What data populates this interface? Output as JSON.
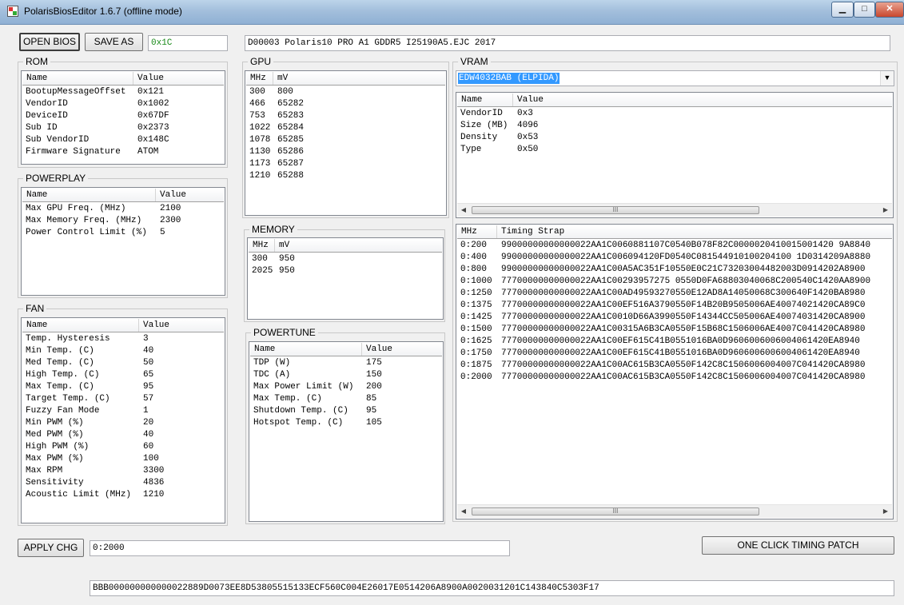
{
  "window": {
    "title": "PolarisBiosEditor 1.6.7 (offline mode)",
    "minimize": "▁",
    "maximize": "□",
    "close": "✕"
  },
  "toolbar": {
    "open_label": "OPEN BIOS",
    "save_label": "SAVE AS",
    "checksum": "0x1C",
    "bios_info": "D00003 Polaris10 PRO A1 GDDR5 I25190A5.EJC 2017"
  },
  "rom": {
    "title": "ROM",
    "columns": [
      "Name",
      "Value"
    ],
    "rows": [
      [
        "BootupMessageOffset",
        "0x121"
      ],
      [
        "VendorID",
        "0x1002"
      ],
      [
        "DeviceID",
        "0x67DF"
      ],
      [
        "Sub ID",
        "0x2373"
      ],
      [
        "Sub VendorID",
        "0x148C"
      ],
      [
        "Firmware Signature",
        "ATOM"
      ]
    ]
  },
  "powerplay": {
    "title": "POWERPLAY",
    "columns": [
      "Name",
      "Value"
    ],
    "rows": [
      [
        "Max GPU Freq. (MHz)",
        "2100"
      ],
      [
        "Max Memory Freq. (MHz)",
        "2300"
      ],
      [
        "Power Control Limit (%)",
        "5"
      ]
    ]
  },
  "fan": {
    "title": "FAN",
    "columns": [
      "Name",
      "Value"
    ],
    "rows": [
      [
        "Temp. Hysteresis",
        "3"
      ],
      [
        "Min Temp. (C)",
        "40"
      ],
      [
        "Med Temp. (C)",
        "50"
      ],
      [
        "High Temp. (C)",
        "65"
      ],
      [
        "Max Temp. (C)",
        "95"
      ],
      [
        "Target Temp. (C)",
        "57"
      ],
      [
        "Fuzzy Fan Mode",
        "1"
      ],
      [
        "Min PWM (%)",
        "20"
      ],
      [
        "Med PWM (%)",
        "40"
      ],
      [
        "High PWM (%)",
        "60"
      ],
      [
        "Max PWM (%)",
        "100"
      ],
      [
        "Max RPM",
        "3300"
      ],
      [
        "Sensitivity",
        "4836"
      ],
      [
        "Acoustic Limit (MHz)",
        "1210"
      ]
    ]
  },
  "gpu": {
    "title": "GPU",
    "columns": [
      "MHz",
      "mV"
    ],
    "rows": [
      [
        "300",
        "800"
      ],
      [
        "466",
        "65282"
      ],
      [
        "753",
        "65283"
      ],
      [
        "1022",
        "65284"
      ],
      [
        "1078",
        "65285"
      ],
      [
        "1130",
        "65286"
      ],
      [
        "1173",
        "65287"
      ],
      [
        "1210",
        "65288"
      ]
    ]
  },
  "memory": {
    "title": "MEMORY",
    "columns": [
      "MHz",
      "mV"
    ],
    "rows": [
      [
        "300",
        "950"
      ],
      [
        "2025",
        "950"
      ]
    ]
  },
  "powertune": {
    "title": "POWERTUNE",
    "columns": [
      "Name",
      "Value"
    ],
    "rows": [
      [
        "TDP (W)",
        "175"
      ],
      [
        "TDC (A)",
        "150"
      ],
      [
        "Max Power Limit (W)",
        "200"
      ],
      [
        "Max Temp. (C)",
        "85"
      ],
      [
        "Shutdown Temp. (C)",
        "95"
      ],
      [
        "Hotspot Temp. (C)",
        "105"
      ]
    ]
  },
  "vram": {
    "title": "VRAM",
    "selected_chip": "EDW4032BAB (ELPIDA)",
    "columns": [
      "Name",
      "Value"
    ],
    "rows": [
      [
        "VendorID",
        "0x3"
      ],
      [
        "Size (MB)",
        "4096"
      ],
      [
        "Density",
        "0x53"
      ],
      [
        "Type",
        "0x50"
      ]
    ],
    "timing_columns": [
      "MHz",
      "Timing Strap"
    ],
    "timings": [
      [
        "0:200",
        "99000000000000022AA1C0060881107C0540B078F82C0000020410015001420 9A8840"
      ],
      [
        "0:400",
        "99000000000000022AA1C006094120FD0540C081544910100204100 1D0314209A8880"
      ],
      [
        "0:800",
        "99000000000000022AA1C00A5AC351F10550E0C21C73203004482003D0914202A8900"
      ],
      [
        "0:1000",
        "77700000000000022AA1C00293957275 0550D0FA68803040068C200540C1420AA8900"
      ],
      [
        "0:1250",
        "77700000000000022AA1C00AD49593270550E12AD8A14050068C300640F1420BA8980"
      ],
      [
        "0:1375",
        "77700000000000022AA1C00EF516A3790550F14B20B9505006AE40074021420CA89C0"
      ],
      [
        "0:1425",
        "77700000000000022AA1C0010D66A3990550F14344CC505006AE40074031420CA8900"
      ],
      [
        "0:1500",
        "77700000000000022AA1C00315A6B3CA0550F15B68C1506006AE4007C041420CA8980"
      ],
      [
        "0:1625",
        "77700000000000022AA1C00EF615C41B0551016BA0D9606006006004061420EA8940"
      ],
      [
        "0:1750",
        "77700000000000022AA1C00EF615C41B0551016BA0D9606006006004061420EA8940"
      ],
      [
        "0:1875",
        "77700000000000022AA1C00AC615B3CA0550F142C8C1506006004007C041420CA8980"
      ],
      [
        "0:2000",
        "77700000000000022AA1C00AC615B3CA0550F142C8C1506006004007C041420CA8980"
      ]
    ]
  },
  "bottom": {
    "apply_label": "APPLY CHG",
    "selected_entry": "0:2000",
    "timing_patch_label": "ONE CLICK TIMING PATCH",
    "strap_value": "BBB000000000000022889D0073EE8D53805515133ECF560C004E26017E0514206A8900A0020031201C143840C5303F17"
  },
  "scroll": {
    "left_arrow": "◀",
    "right_arrow": "▶",
    "thumb_grip": "III",
    "dropdown_arrow": "▼"
  }
}
